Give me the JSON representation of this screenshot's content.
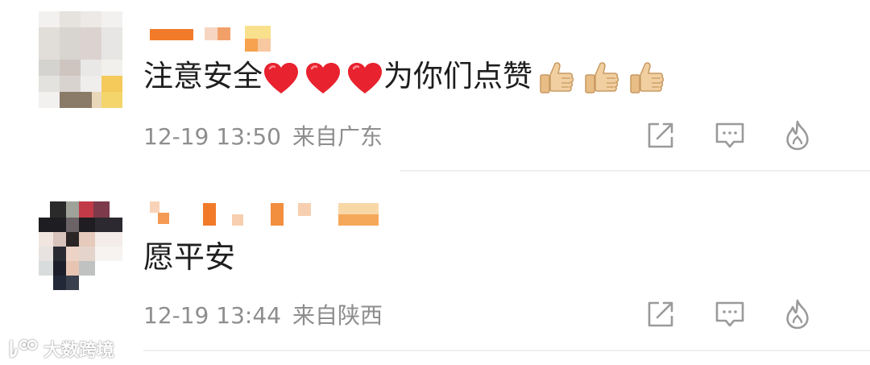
{
  "comments": [
    {
      "text_before": "注意安全",
      "text_middle": "为你们点赞",
      "time": "12-19 13:50",
      "location": "来自广东",
      "emojis_hearts": [
        "heart-emoji",
        "heart-emoji",
        "heart-emoji"
      ],
      "emojis_thumbs": [
        "thumbs-up-emoji",
        "thumbs-up-emoji",
        "thumbs-up-emoji"
      ]
    },
    {
      "text": "愿平安",
      "time": "12-19 13:44",
      "location": "来自陕西"
    }
  ],
  "actions": {
    "share_icon": "share-icon",
    "comment_icon": "comment-icon",
    "like_icon": "fire-icon"
  },
  "watermark": {
    "text": "大数跨境"
  },
  "colors": {
    "text_primary": "#1e1e1e",
    "text_secondary": "#8e8e8e",
    "icon": "#9a9a9a",
    "divider": "#efefef",
    "heart": "#e8222f",
    "name_orange": "#f27b2a"
  }
}
